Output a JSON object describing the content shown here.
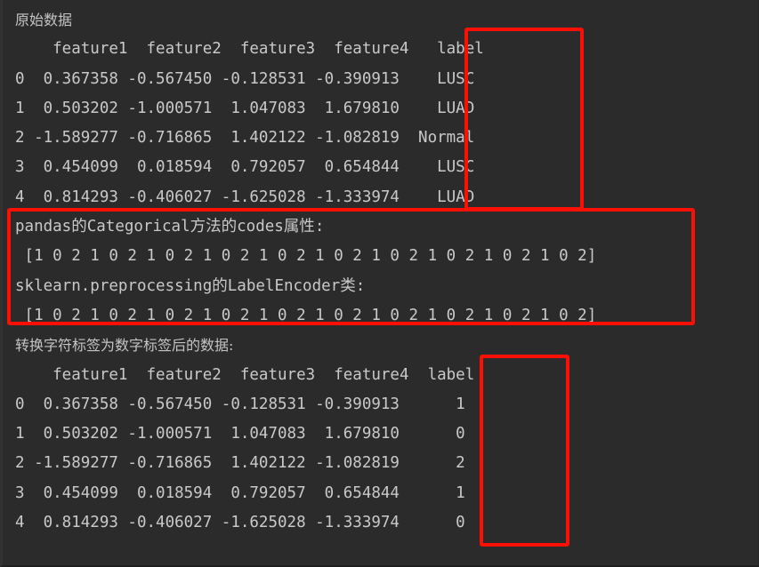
{
  "terminal": {
    "background_color": "#2b2b2b",
    "text_color": "#c9c9c9",
    "highlight_color": "#fc1005"
  },
  "sections": {
    "original_heading": "原始数据",
    "converted_heading": "转换字符标签为数字标签后的数据:"
  },
  "original_table": {
    "header": "    feature1  feature2  feature3  feature4   label",
    "rows": [
      "0  0.367358 -0.567450 -0.128531 -0.390913    LUSC",
      "1  0.503202 -1.000571  1.047083  1.679810    LUAD",
      "2 -1.589277 -0.716865  1.402122 -1.082819  Normal",
      "3  0.454099  0.018594  0.792057  0.654844    LUSC",
      "4  0.814293 -0.406027 -1.625028 -1.333974    LUAD"
    ],
    "columns": [
      "feature1",
      "feature2",
      "feature3",
      "feature4",
      "label"
    ],
    "index": [
      "0",
      "1",
      "2",
      "3",
      "4"
    ],
    "data": [
      [
        "0.367358",
        "-0.567450",
        "-0.128531",
        "-0.390913",
        "LUSC"
      ],
      [
        "0.503202",
        "-1.000571",
        "1.047083",
        "1.679810",
        "LUAD"
      ],
      [
        "-1.589277",
        "-0.716865",
        "1.402122",
        "-1.082819",
        "Normal"
      ],
      [
        "0.454099",
        "0.018594",
        "0.792057",
        "0.654844",
        "LUSC"
      ],
      [
        "0.814293",
        "-0.406027",
        "-1.625028",
        "-1.333974",
        "LUAD"
      ]
    ]
  },
  "codes_block": {
    "pandas_caption": "pandas的Categorical方法的codes属性:",
    "pandas_array": " [1 0 2 1 0 2 1 0 2 1 0 2 1 0 2 1 0 2 1 0 2 1 0 2 1 0 2 1 0 2]",
    "sklearn_caption": "sklearn.preprocessing的LabelEncoder类:",
    "sklearn_array": " [1 0 2 1 0 2 1 0 2 1 0 2 1 0 2 1 0 2 1 0 2 1 0 2 1 0 2 1 0 2]",
    "values": [
      1,
      0,
      2,
      1,
      0,
      2,
      1,
      0,
      2,
      1,
      0,
      2,
      1,
      0,
      2,
      1,
      0,
      2,
      1,
      0,
      2,
      1,
      0,
      2,
      1,
      0,
      2,
      1,
      0,
      2
    ]
  },
  "converted_table": {
    "header": "    feature1  feature2  feature3  feature4  label",
    "rows": [
      "0  0.367358 -0.567450 -0.128531 -0.390913      1",
      "1  0.503202 -1.000571  1.047083  1.679810      0",
      "2 -1.589277 -0.716865  1.402122 -1.082819      2",
      "3  0.454099  0.018594  0.792057  0.654844      1",
      "4  0.814293 -0.406027 -1.625028 -1.333974      0"
    ],
    "columns": [
      "feature1",
      "feature2",
      "feature3",
      "feature4",
      "label"
    ],
    "index": [
      "0",
      "1",
      "2",
      "3",
      "4"
    ],
    "data": [
      [
        "0.367358",
        "-0.567450",
        "-0.128531",
        "-0.390913",
        "1"
      ],
      [
        "0.503202",
        "-1.000571",
        "1.047083",
        "1.679810",
        "0"
      ],
      [
        "-1.589277",
        "-0.716865",
        "1.402122",
        "-1.082819",
        "2"
      ],
      [
        "0.454099",
        "0.018594",
        "0.792057",
        "0.654844",
        "1"
      ],
      [
        "0.814293",
        "-0.406027",
        "-1.625028",
        "-1.333974",
        "0"
      ]
    ]
  }
}
